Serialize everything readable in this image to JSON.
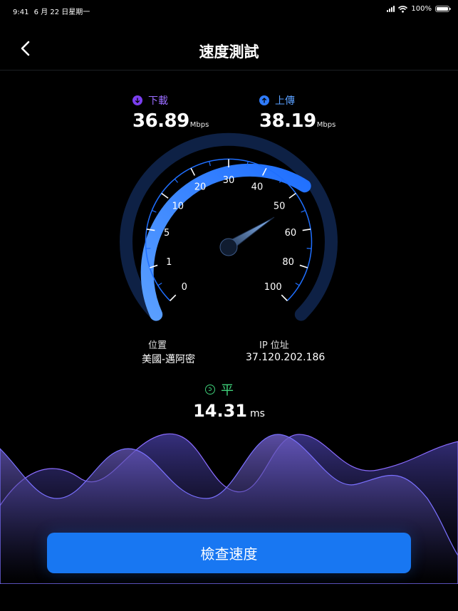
{
  "status_bar": {
    "time": "9:41",
    "date": "6 月 22 日星期一",
    "battery": "100%"
  },
  "header": {
    "title": "速度測試"
  },
  "download": {
    "label": "下載",
    "value": "36.89",
    "unit": "Mbps"
  },
  "upload": {
    "label": "上傳",
    "value": "38.19",
    "unit": "Mbps"
  },
  "gauge": {
    "scale_labels": [
      "0",
      "1",
      "5",
      "10",
      "20",
      "30",
      "40",
      "50",
      "60",
      "80",
      "100"
    ],
    "needle_value": "50"
  },
  "location": {
    "label": "位置",
    "value": "美國-邁阿密"
  },
  "ip": {
    "label": "IP 位址",
    "value": "37.120.202.186"
  },
  "ping": {
    "label": "平",
    "value": "14.31",
    "unit": "ms"
  },
  "action": {
    "button_label": "檢查速度"
  },
  "colors": {
    "accent": "#1877f2",
    "download": "#7b3ff0",
    "upload": "#2f7cff",
    "ping": "#3fd07a"
  }
}
